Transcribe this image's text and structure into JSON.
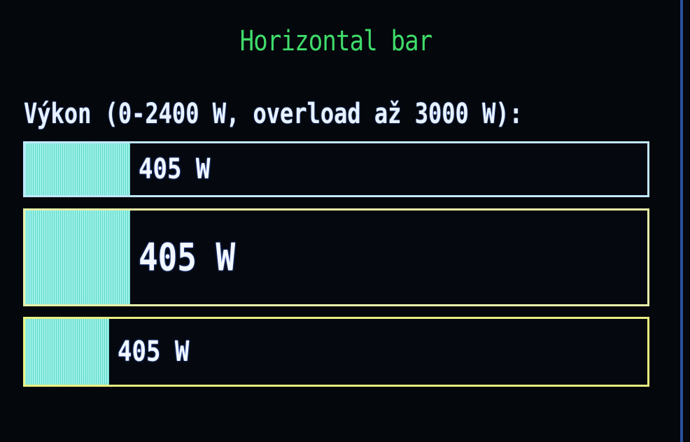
{
  "title": "Horizontal bar",
  "label": "Výkon (0-2400 W, overload až 3000 W):",
  "colors": {
    "title": "#3fdc6a",
    "fill": "#7fe6da",
    "text": "#f2f8ff",
    "border_top": "#bfe8ff",
    "border_other": "#e8f080"
  },
  "bars": [
    {
      "value_text": "405 W",
      "value": 405,
      "max": 2400,
      "fill_fraction": 0.169
    },
    {
      "value_text": "405 W",
      "value": 405,
      "max": 2400,
      "fill_fraction": 0.169
    },
    {
      "value_text": "405 W",
      "value": 405,
      "max": 3000,
      "fill_fraction": 0.135
    }
  ]
}
